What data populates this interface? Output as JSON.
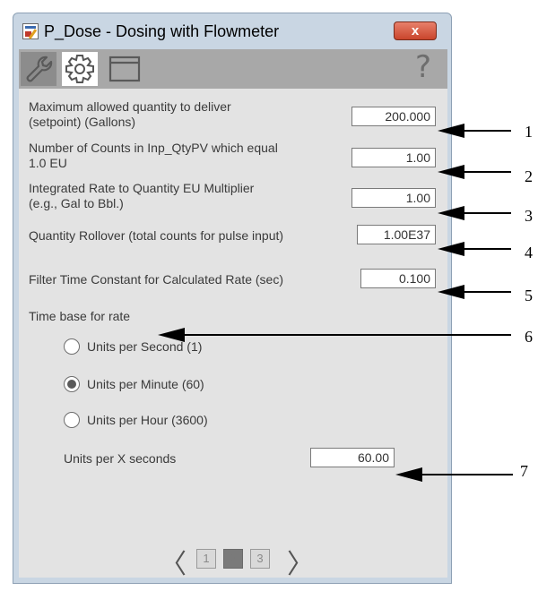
{
  "window": {
    "title": "P_Dose - Dosing with Flowmeter",
    "close_label": "x"
  },
  "toolbar": {
    "tabs": [
      {
        "icon": "wrench-icon"
      },
      {
        "icon": "gear-icon"
      },
      {
        "icon": "window-icon"
      }
    ],
    "help_label": "?"
  },
  "settings": [
    {
      "label_l1": "Maximum allowed quantity to deliver",
      "label_l2": "(setpoint) (Gallons)",
      "value": "200.000"
    },
    {
      "label_l1": "Number of Counts in Inp_QtyPV which equal",
      "label_l2": "1.0 EU",
      "value": "1.00"
    },
    {
      "label_l1": "Integrated Rate to Quantity EU Multiplier",
      "label_l2": "(e.g., Gal to Bbl.)",
      "value": "1.00"
    },
    {
      "label_l1": "Quantity Rollover (total counts for pulse input)",
      "label_l2": "",
      "value": "1.00E37"
    },
    {
      "label_l1": "Filter Time Constant for Calculated Rate (sec)",
      "label_l2": "",
      "value": "0.100"
    }
  ],
  "time_base": {
    "label": "Time base for rate",
    "options": [
      {
        "label": "Units per Second (1)",
        "selected": false
      },
      {
        "label": "Units per Minute (60)",
        "selected": true
      },
      {
        "label": "Units per Hour (3600)",
        "selected": false
      }
    ],
    "x_seconds_label": "Units per X seconds",
    "x_seconds_value": "60.00"
  },
  "pager": {
    "prev": "〈",
    "next": "〉",
    "pages": [
      "1",
      "2",
      "3"
    ],
    "current": "2"
  },
  "callouts": [
    "1",
    "2",
    "3",
    "4",
    "5",
    "6",
    "7"
  ]
}
